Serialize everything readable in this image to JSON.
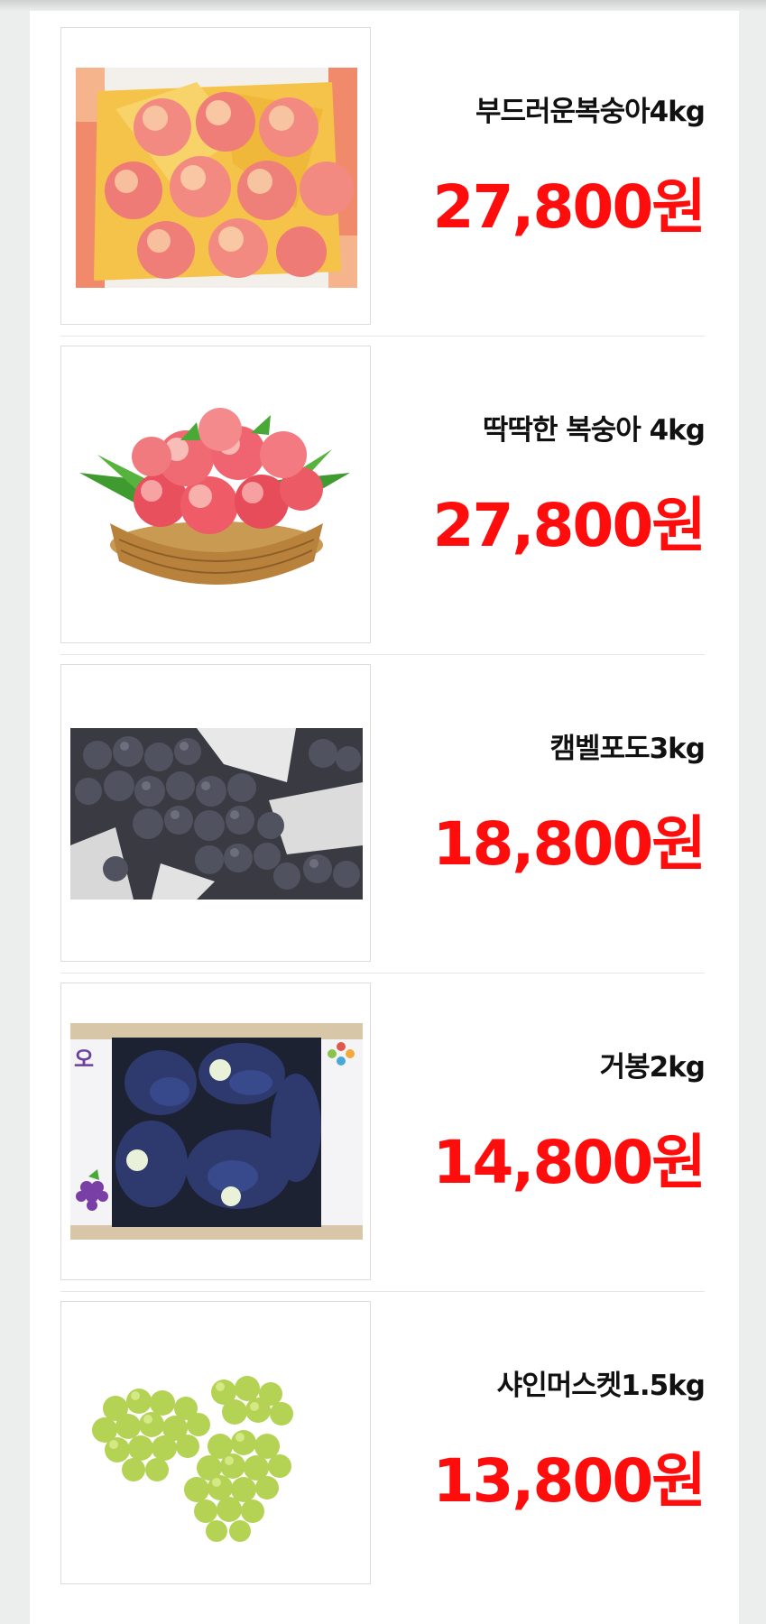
{
  "products": [
    {
      "name": "부드러운복숭아4kg",
      "price": "27,800원",
      "image_icon": "peach-box-image"
    },
    {
      "name": "딱딱한 복숭아 4kg",
      "price": "27,800원",
      "image_icon": "peach-basket-image"
    },
    {
      "name": "캠벨포도3kg",
      "price": "18,800원",
      "image_icon": "campbell-grape-image"
    },
    {
      "name": "거봉2kg",
      "price": "14,800원",
      "image_icon": "kyoho-grape-box-image"
    },
    {
      "name": "샤인머스켓1.5kg",
      "price": "13,800원",
      "image_icon": "shine-muscat-image"
    }
  ],
  "colors": {
    "price": "#ff0d0d",
    "name": "#111111",
    "background": "#eceeee",
    "card": "#ffffff"
  }
}
